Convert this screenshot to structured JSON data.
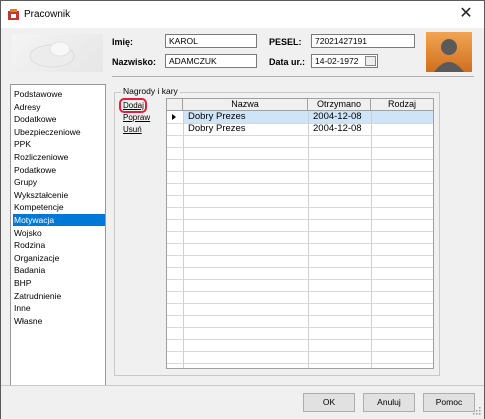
{
  "window": {
    "title": "Pracownik",
    "close_glyph": "✕"
  },
  "header": {
    "imie_label": "Imię:",
    "imie_value": "KAROL",
    "nazwisko_label": "Nazwisko:",
    "nazwisko_value": "ADAMCZUK",
    "pesel_label": "PESEL:",
    "pesel_value": "72021427191",
    "data_label": "Data ur.:",
    "data_value": "14-02-1972"
  },
  "sidebar": {
    "items": [
      {
        "label": "Podstawowe"
      },
      {
        "label": "Adresy"
      },
      {
        "label": "Dodatkowe"
      },
      {
        "label": "Ubezpieczeniowe"
      },
      {
        "label": "PPK"
      },
      {
        "label": "Rozliczeniowe"
      },
      {
        "label": "Podatkowe"
      },
      {
        "label": "Grupy"
      },
      {
        "label": "Wykształcenie"
      },
      {
        "label": "Kompetencje"
      },
      {
        "label": "Motywacja"
      },
      {
        "label": "Wojsko"
      },
      {
        "label": "Rodzina"
      },
      {
        "label": "Organizacje"
      },
      {
        "label": "Badania"
      },
      {
        "label": "BHP"
      },
      {
        "label": "Zatrudnienie"
      },
      {
        "label": "Inne"
      },
      {
        "label": "Własne"
      }
    ],
    "selected_index": 10
  },
  "group": {
    "title": "Nagrody i kary",
    "actions": {
      "add": "Dodaj",
      "edit": "Popraw",
      "delete": "Usuń"
    }
  },
  "table": {
    "columns": [
      "Nazwa",
      "Otrzymano",
      "Rodzaj"
    ],
    "rows": [
      {
        "nazwa": "Dobry Prezes",
        "otrzymano": "2004-12-08",
        "rodzaj": ""
      },
      {
        "nazwa": "Dobry Prezes",
        "otrzymano": "2004-12-08",
        "rodzaj": ""
      }
    ],
    "selected_row": 0
  },
  "buttons": {
    "ok": "OK",
    "cancel": "Anuluj",
    "help": "Pomoc"
  },
  "colors": {
    "accent": "#0078d7",
    "selected_row": "#cfe4f7",
    "highlight_ring": "#e0203a"
  },
  "icons": {
    "app": "app-icon",
    "calendar": "calendar-icon",
    "avatar": "user-avatar-icon",
    "close": "close-icon",
    "row_indicator": "row-indicator-icon"
  }
}
